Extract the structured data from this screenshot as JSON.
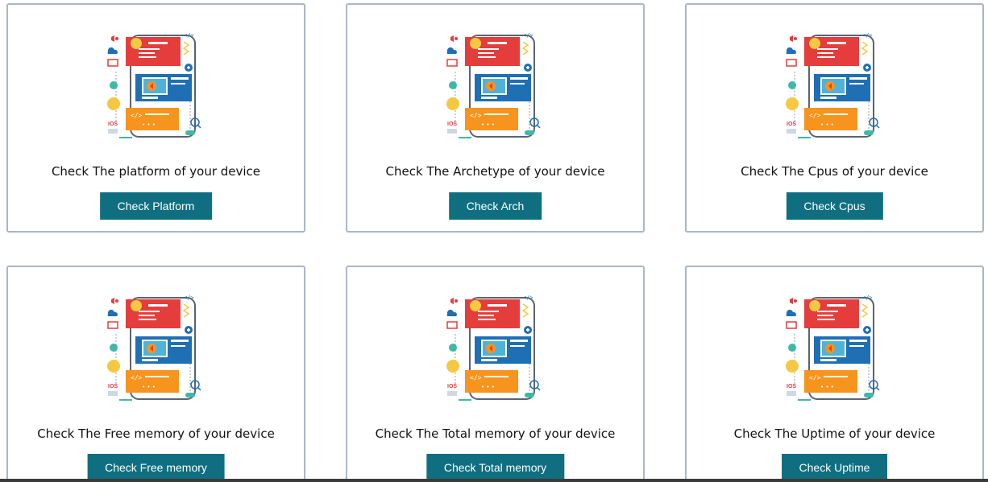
{
  "cards": [
    {
      "caption": "Check The platform of your device",
      "button": "Check Platform"
    },
    {
      "caption": "Check The Archetype of your device",
      "button": "Check Arch"
    },
    {
      "caption": "Check The Cpus of your device",
      "button": "Check Cpus"
    },
    {
      "caption": "Check The Free memory of your device",
      "button": "Check Free memory"
    },
    {
      "caption": "Check The Total memory of your device",
      "button": "Check Total memory"
    },
    {
      "caption": "Check The Uptime of your device",
      "button": "Check Uptime"
    }
  ],
  "illustration": {
    "ios_label": "IOS",
    "code_tag": "</>",
    "dots": "• • •"
  },
  "colors": {
    "button": "#0f6f80",
    "card_border": "#a9b6c8",
    "red_panel": "#e53d3b",
    "blue_panel": "#1f6fb5",
    "orange_panel": "#f7941d",
    "yellow": "#f5c842",
    "teal": "#3fb8a8"
  }
}
